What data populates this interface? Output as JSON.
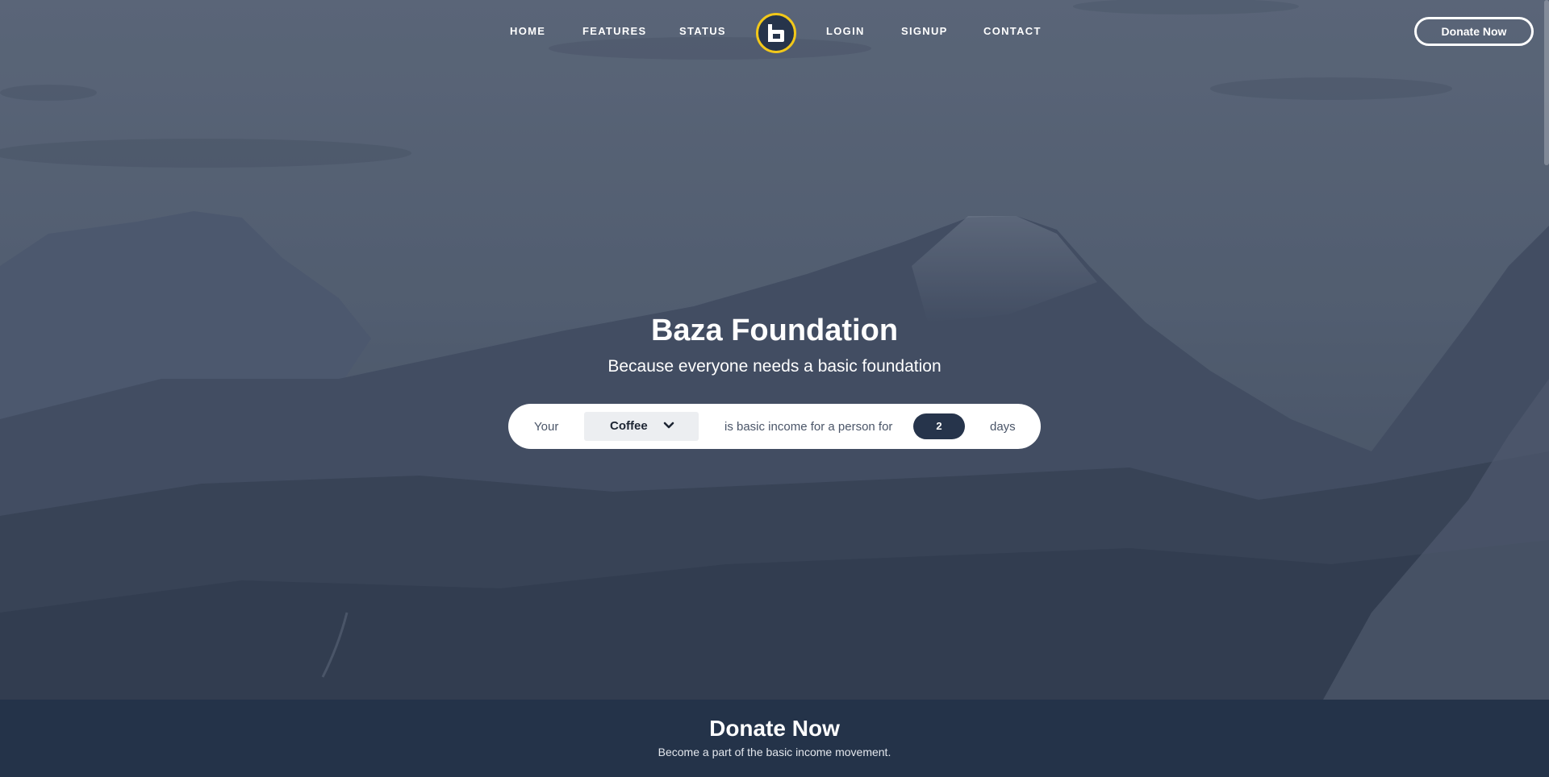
{
  "nav": {
    "links": [
      "HOME",
      "FEATURES",
      "STATUS",
      "LOGIN",
      "SIGNUP",
      "CONTACT"
    ],
    "logo_icon": "baza-logo-icon",
    "donate_button": "Donate Now"
  },
  "hero": {
    "title": "Baza Foundation",
    "subtitle": "Because everyone needs a basic foundation"
  },
  "calculator": {
    "prefix": "Your",
    "item_selected": "Coffee",
    "middle": "is basic income for a person for",
    "days_value": "2",
    "suffix": "days"
  },
  "donate": {
    "title": "Donate Now",
    "subtitle": "Become a part of the basic income movement."
  },
  "colors": {
    "navy": "#26344b",
    "accent_yellow": "#f2c81a",
    "section_bg": "#243349"
  }
}
